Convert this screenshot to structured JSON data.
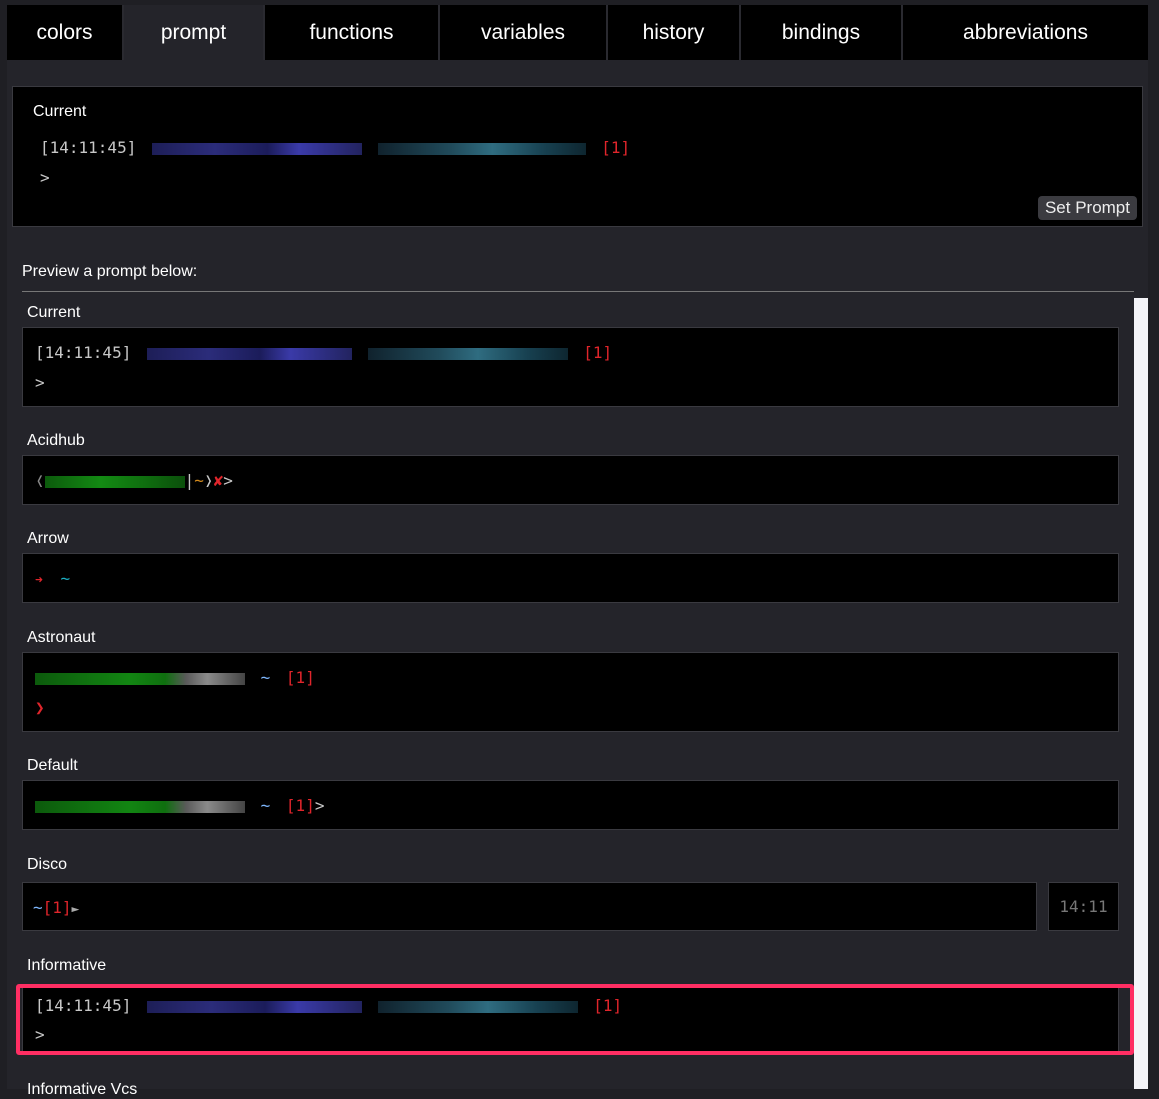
{
  "tabs": [
    "colors",
    "prompt",
    "functions",
    "variables",
    "history",
    "bindings",
    "abbreviations"
  ],
  "active_tab": "prompt",
  "current": {
    "label": "Current",
    "time": "[14:11:45]",
    "status": "[1]",
    "prompt_char": ">",
    "set_button": "Set Prompt"
  },
  "preview_heading": "Preview a prompt below:",
  "prompts": {
    "current": {
      "label": "Current",
      "time": "[14:11:45]",
      "status": "[1]",
      "char": ">"
    },
    "acidhub": {
      "label": "Acidhub",
      "open": "❬",
      "sep": "|",
      "tilde": "~",
      "close": "❭",
      "cross": "✘",
      "char": ">"
    },
    "arrow": {
      "label": "Arrow",
      "arrow": "➜",
      "tilde": "~"
    },
    "astronaut": {
      "label": "Astronaut",
      "tilde": "~",
      "status": "[1]",
      "char": "❯"
    },
    "default": {
      "label": "Default",
      "tilde": "~",
      "status": "[1]",
      "char": ">"
    },
    "disco": {
      "label": "Disco",
      "tilde": "~",
      "status": "[1]",
      "char": "►",
      "right_time": "14:11"
    },
    "informative": {
      "label": "Informative",
      "time": "[14:11:45]",
      "status": "[1]",
      "char": ">"
    },
    "informative_next": {
      "label": "Informative Vcs"
    }
  },
  "colors": {
    "highlight": "#ff2e63",
    "status_red": "#e0252b",
    "active_tab_bg": "#24242a"
  }
}
